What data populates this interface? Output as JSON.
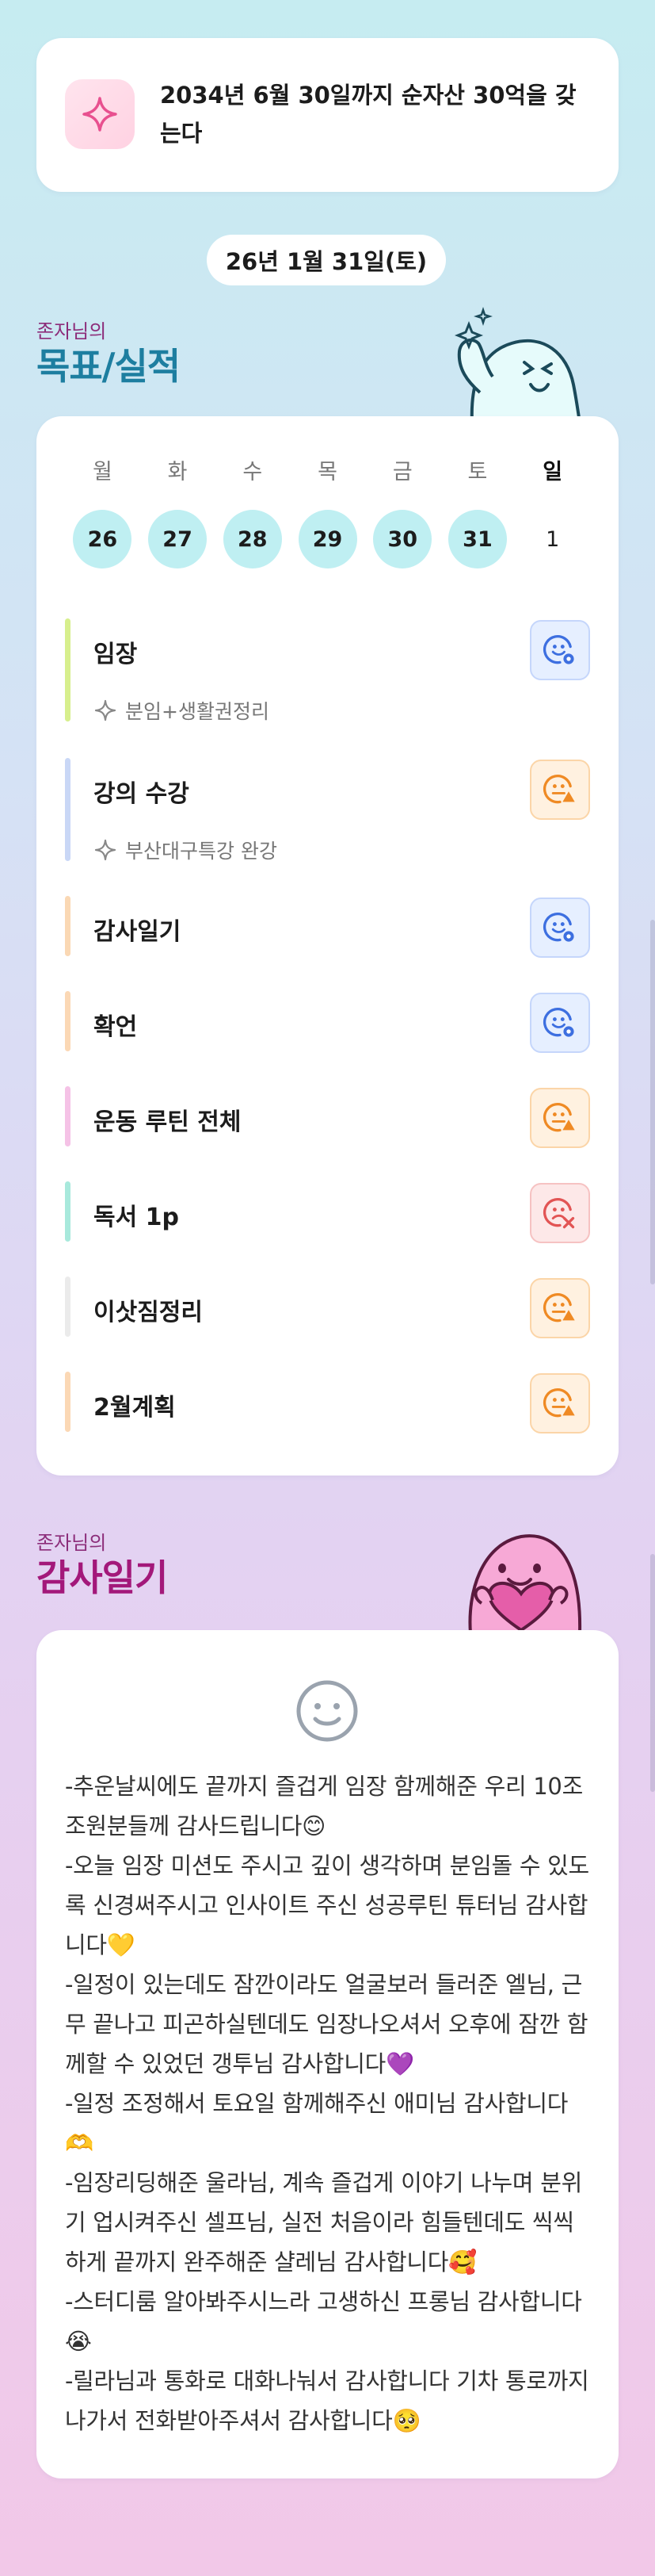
{
  "goal": {
    "text": "2034년 6월 30일까지 순자산 30억을 갖는다",
    "icon": "sparkle-icon"
  },
  "date_label": "26년 1월 31일(토)",
  "records": {
    "subtitle": "존자님의",
    "title": "목표/실적",
    "weekdays": [
      "월",
      "화",
      "수",
      "목",
      "금",
      "토",
      "일"
    ],
    "dates": [
      {
        "label": "26",
        "done": true
      },
      {
        "label": "27",
        "done": true
      },
      {
        "label": "28",
        "done": true
      },
      {
        "label": "29",
        "done": true
      },
      {
        "label": "30",
        "done": true
      },
      {
        "label": "31",
        "done": true
      },
      {
        "label": "1",
        "done": false
      }
    ],
    "tasks": [
      {
        "title": "임장",
        "sub": "분임+생활권정리",
        "status": "good",
        "color": "#d7ef8d"
      },
      {
        "title": "강의 수강",
        "sub": "부산대구특강 완강",
        "status": "warn",
        "color": "#c9d7f6"
      },
      {
        "title": "감사일기",
        "sub": "",
        "status": "good",
        "color": "#fad8b4"
      },
      {
        "title": "확언",
        "sub": "",
        "status": "good",
        "color": "#fbd8b5"
      },
      {
        "title": "운동 루틴 전체",
        "sub": "",
        "status": "warn",
        "color": "#f5c2e6"
      },
      {
        "title": "독서 1p",
        "sub": "",
        "status": "bad",
        "color": "#a8e9dc"
      },
      {
        "title": "이삿짐정리",
        "sub": "",
        "status": "warn",
        "color": "#ebebeb"
      },
      {
        "title": "2월계획",
        "sub": "",
        "status": "warn",
        "color": "#fbd8b5"
      }
    ]
  },
  "gratitude": {
    "subtitle": "존자님의",
    "title": "감사일기",
    "paragraphs": [
      "-추운날씨에도 끝까지 즐겁게 임장 함께해준 우리 10조 조원분들께 감사드립니다😊",
      "-오늘 임장 미션도 주시고 깊이 생각하며 분임돌 수 있도록 신경써주시고 인사이트 주신 성공루틴 튜터님 감사합니다💛",
      "-일정이 있는데도 잠깐이라도 얼굴보러 들러준 엘님, 근무 끝나고 피곤하실텐데도 임장나오셔서 오후에 잠깐 함께할 수 있었던 갱투님 감사합니다💜",
      "-일정 조정해서 토요일 함께해주신 애미님 감사합니다🫶",
      "-임장리딩해준 울라님, 계속 즐겁게 이야기 나누며 분위기 업시켜주신 셀프님, 실전 처음이라 힘들텐데도 씩씩하게 끝까지 완주해준 샬레님 감사합니다🥰",
      "-스터디룸 알아봐주시느라 고생하신 프롱님 감사합니다😭",
      "-릴라님과 통화로 대화나눠서 감사합니다 기차 통로까지 나가서 전화받아주셔서 감사합니다🥺"
    ]
  },
  "colors": {
    "accent_blue": "#1d7ea0",
    "accent_pink": "#a3187a",
    "date_done": "#bfeff2"
  }
}
